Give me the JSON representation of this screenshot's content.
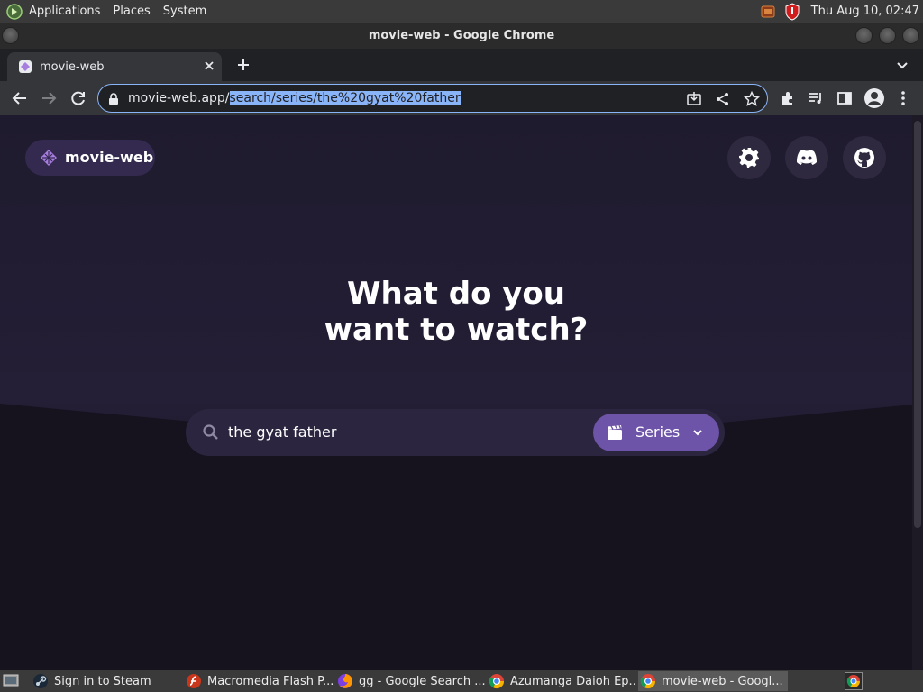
{
  "system_panel": {
    "menus": [
      "Applications",
      "Places",
      "System"
    ],
    "clock": "Thu Aug 10, 02:47"
  },
  "window": {
    "title": "movie-web - Google Chrome"
  },
  "browser": {
    "tab": {
      "title": "movie-web"
    },
    "url_host": "movie-web.app/",
    "url_path_selected": "search/series/the%20gyat%20father"
  },
  "page": {
    "brand": "movie-web",
    "headline_line1": "What do you",
    "headline_line2": "want to watch?",
    "search": {
      "query": "the gyat father"
    },
    "type_select": {
      "value": "Series"
    }
  },
  "taskbar": {
    "tasks": [
      {
        "label": "Sign in to Steam",
        "icon": "steam-icon"
      },
      {
        "label": "Macromedia Flash P...",
        "icon": "flash-icon"
      },
      {
        "label": "gg - Google Search ...",
        "icon": "firefox-icon"
      },
      {
        "label": "Azumanga Daioh Ep...",
        "icon": "chrome-icon"
      },
      {
        "label": "movie-web - Googl...",
        "icon": "chrome-icon"
      }
    ]
  },
  "colors": {
    "accent": "#6d54a8",
    "page_bg": "#1f1b2e",
    "url_selection": "#8ab4f8"
  }
}
